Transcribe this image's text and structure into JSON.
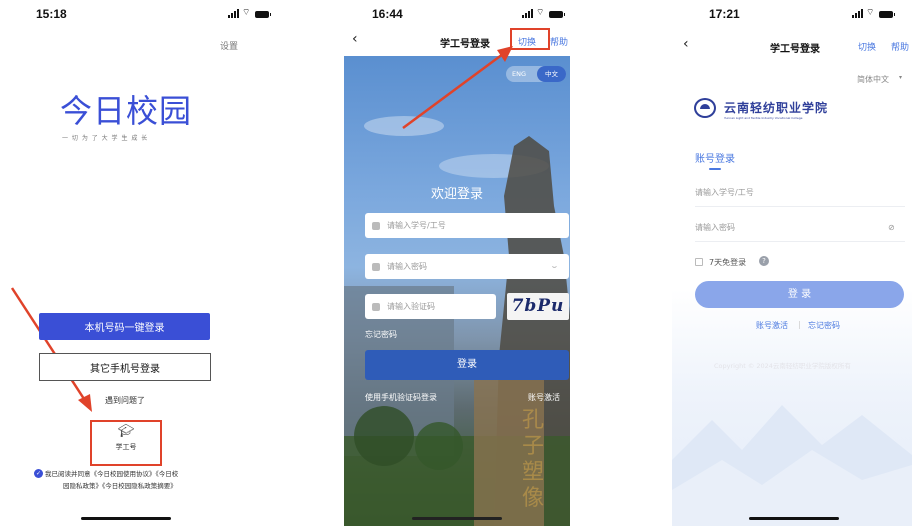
{
  "panel1": {
    "time": "15:18",
    "settings": "设置",
    "logo_title": "今日校园",
    "slogan": "一 切 为 了 大 学 生 成 长",
    "one_click_login": "本机号码一键登录",
    "other_phone_login": "其它手机号登录",
    "problem": "遇到问题了",
    "student_id_label": "学工号",
    "agreement_line1": "我已阅读并同意《今日校园使用协议》《今日校",
    "agreement_line2": "园隐私政策》《今日校园隐私政策摘要》"
  },
  "panel2": {
    "time": "16:44",
    "title": "学工号登录",
    "switch": "切换",
    "help": "帮助",
    "lang_eng": "ENG",
    "lang_zh": "中文",
    "welcome": "欢迎登录",
    "account_placeholder": "请输入学号/工号",
    "password_placeholder": "请输入密码",
    "captcha_placeholder": "请输入验证码",
    "captcha_text": "7bPu",
    "forgot_password": "忘记密码",
    "login_button": "登录",
    "sms_login": "使用手机验证码登录",
    "account_activate": "账号激活",
    "statue_calligraphy": "孔子塑像"
  },
  "panel3": {
    "time": "17:21",
    "title": "学工号登录",
    "switch": "切换",
    "help": "帮助",
    "language": "简体中文",
    "school_name": "云南轻纺职业学院",
    "school_name_en": "Yunnan Light and Textile Industry Vocational College",
    "tab_account": "账号登录",
    "account_placeholder": "请输入学号/工号",
    "password_placeholder": "请输入密码",
    "remember": "7天免登录",
    "login_button": "登 录",
    "account_activate": "账号激活",
    "forgot_password": "忘记密码",
    "copyright": "Copyright © 2024云南轻纺职业学院版权所有"
  },
  "colors": {
    "accent_blue": "#3a4fd6",
    "annotation_red": "#e0432a",
    "link_blue": "#4a78e0",
    "panel3_button": "#8aa6ea"
  }
}
